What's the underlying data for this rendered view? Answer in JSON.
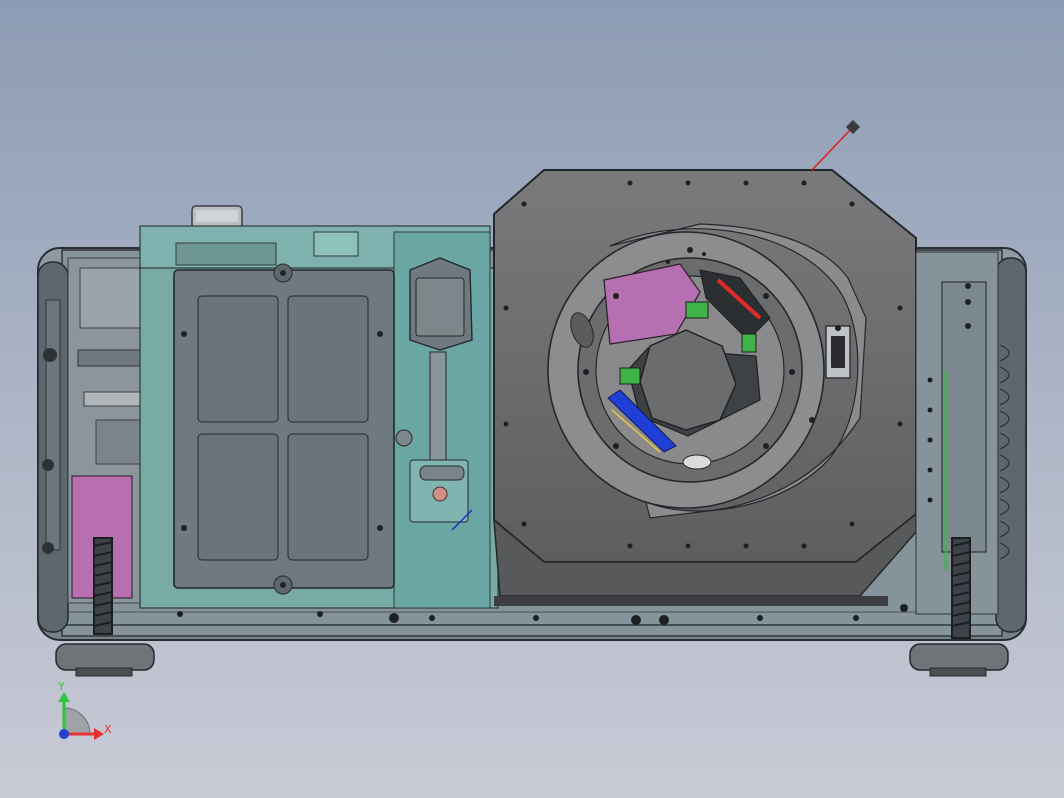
{
  "colors": {
    "background_top": "#8c9cb4",
    "background_bottom": "#c9cbd6",
    "housing": "#7f8a92",
    "panel_teal": "#6aa6a4",
    "lens_plate": "#6e6e70",
    "magenta": "#b76fb0",
    "green": "#3fb34a",
    "blue": "#1f3fd6",
    "cable_red": "#e02020",
    "axis_x": "#e53030",
    "axis_y": "#2ec43a",
    "axis_z": "#2040d0"
  },
  "triad": {
    "x_label": "X",
    "y_label": "Y"
  },
  "icons": {
    "coordinate_triad": "axis-triad-icon"
  }
}
